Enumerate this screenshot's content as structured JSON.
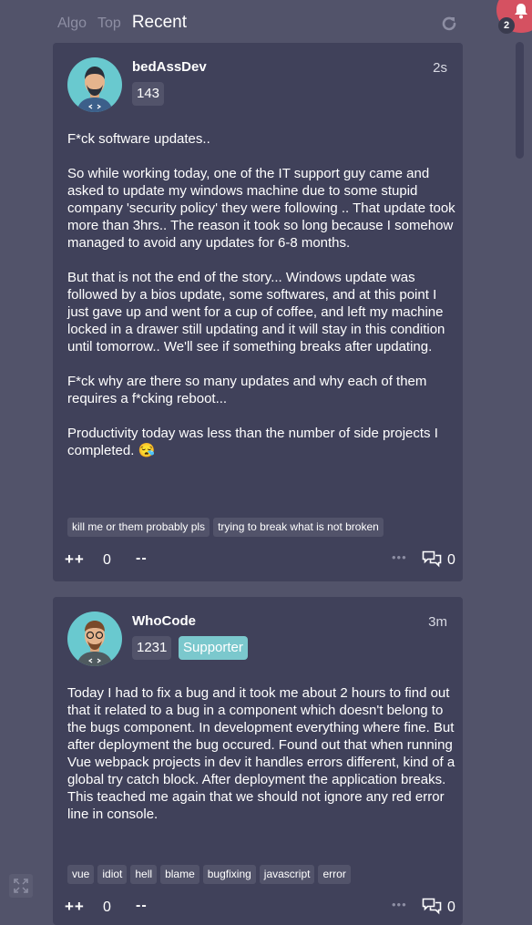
{
  "nav": {
    "tabs": [
      "Algo",
      "Top",
      "Recent"
    ]
  },
  "notifications": {
    "count": "2"
  },
  "posts": [
    {
      "username": "bedAssDev",
      "time": "2s",
      "score": "143",
      "body": "F*ck software updates..\n\nSo while working today, one of the IT support guy came and asked to update my windows machine due to some stupid company 'security policy' they were following .. That update took more than 3hrs.. The reason it took so long because I somehow managed to avoid any updates for 6-8 months.\n\nBut that is not the end of the story... Windows update was followed by a bios update, some softwares, and at this point I just gave up and went for a cup of coffee, and left my machine locked in a drawer still updating and it will stay in this condition until tomorrow.. We'll see if something breaks after updating.\n\nF*ck why are there so many updates and why each of them requires a f*cking reboot...\n\nProductivity today was less than the number of side projects I completed. 😪",
      "tags": [
        "kill me or them probably pls",
        "trying to break what is not broken"
      ],
      "vote_plus": "++",
      "votes": "0",
      "vote_minus": "--",
      "more": "•••",
      "comments": "0"
    },
    {
      "username": "WhoCode",
      "time": "3m",
      "score": "1231",
      "supporter": "Supporter",
      "body": "Today I had to fix a bug and it took me about 2 hours to find out that it related to a bug in a component which doesn't belong to the bugs component. In development everything where fine. But after deployment the bug occured. Found out that when running Vue webpack projects in dev it handles errors different, kind of a global try catch block. After deployment the application breaks. This teached me again that we should not ignore any red error line in console.",
      "tags": [
        "vue",
        "idiot",
        "hell",
        "blame",
        "bugfixing",
        "javascript",
        "error"
      ],
      "vote_plus": "++",
      "votes": "0",
      "vote_minus": "--",
      "more": "•••",
      "comments": "0"
    }
  ]
}
